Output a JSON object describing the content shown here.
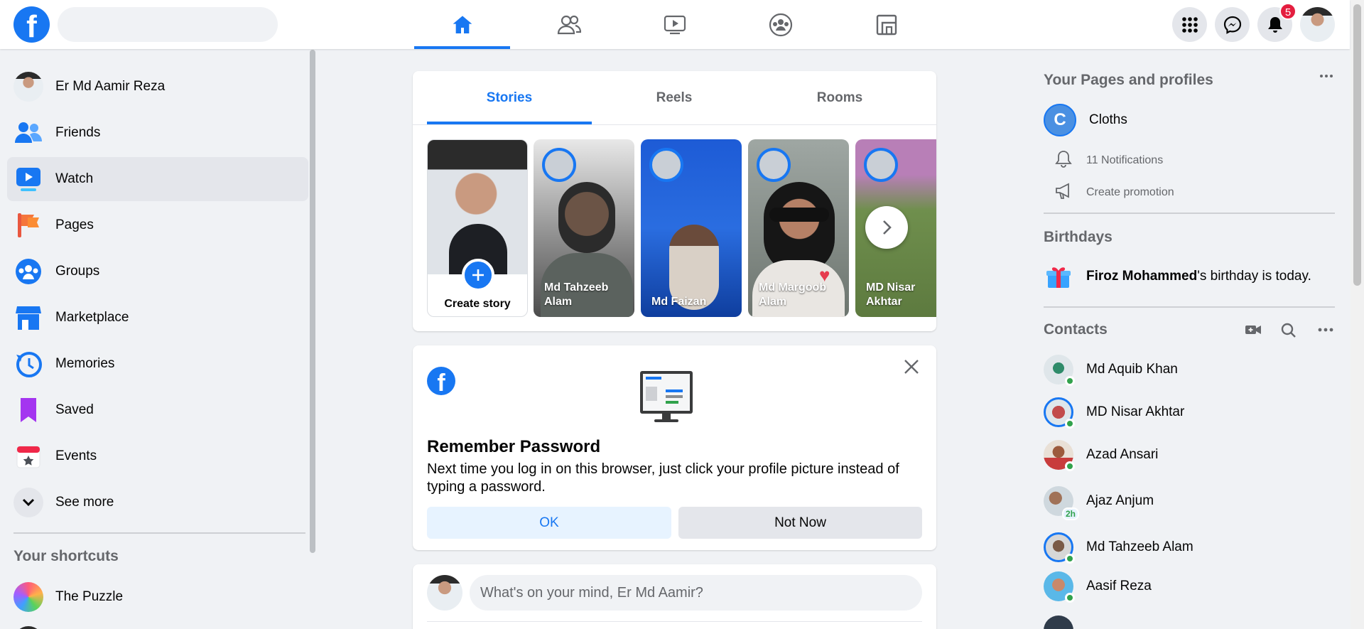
{
  "topbar": {
    "logo_letter": "f",
    "search_placeholder": "",
    "nav": [
      "home-icon",
      "friends-icon",
      "watch-icon",
      "groups-icon",
      "gaming-icon"
    ],
    "notifications_count": "5"
  },
  "left_sidebar": {
    "profile_name": "Er Md Aamir Reza",
    "items": [
      {
        "label": "Friends",
        "icon": "friends-icon"
      },
      {
        "label": "Watch",
        "icon": "watch-icon"
      },
      {
        "label": "Pages",
        "icon": "pages-flag-icon"
      },
      {
        "label": "Groups",
        "icon": "groups-icon"
      },
      {
        "label": "Marketplace",
        "icon": "marketplace-icon"
      },
      {
        "label": "Memories",
        "icon": "memories-icon"
      },
      {
        "label": "Saved",
        "icon": "saved-icon"
      },
      {
        "label": "Events",
        "icon": "events-icon"
      }
    ],
    "see_more": "See more",
    "shortcuts_title": "Your shortcuts",
    "shortcuts": [
      {
        "label": "The Puzzle"
      }
    ]
  },
  "stories": {
    "tabs": [
      "Stories",
      "Reels",
      "Rooms"
    ],
    "create_label": "Create story",
    "items": [
      {
        "name": "Md Tahzeeb Alam"
      },
      {
        "name": "Md Faizan"
      },
      {
        "name": "Md Margoob Alam"
      },
      {
        "name": "MD Nisar Akhtar"
      }
    ]
  },
  "remember": {
    "title": "Remember Password",
    "text": "Next time you log in on this browser, just click your profile picture instead of typing a password.",
    "ok": "OK",
    "not_now": "Not Now"
  },
  "composer": {
    "placeholder": "What's on your mind, Er Md Aamir?"
  },
  "right_sidebar": {
    "pages_title": "Your Pages and profiles",
    "page": {
      "initial": "C",
      "name": "Cloths"
    },
    "notifications": "11 Notifications",
    "create_promotion": "Create promotion",
    "birthdays_title": "Birthdays",
    "birthday_name": "Firoz Mohammed",
    "birthday_suffix": "'s birthday is today.",
    "contacts_title": "Contacts",
    "contacts": [
      {
        "name": "Md Aquib Khan"
      },
      {
        "name": "MD Nisar Akhtar"
      },
      {
        "name": "Azad Ansari"
      },
      {
        "name": "Ajaz Anjum",
        "badge": "2h"
      },
      {
        "name": "Md Tahzeeb Alam"
      },
      {
        "name": "Aasif Reza"
      }
    ]
  },
  "colors": {
    "brand": "#1877f2",
    "online": "#31a24c",
    "badge": "#e41e3f"
  }
}
